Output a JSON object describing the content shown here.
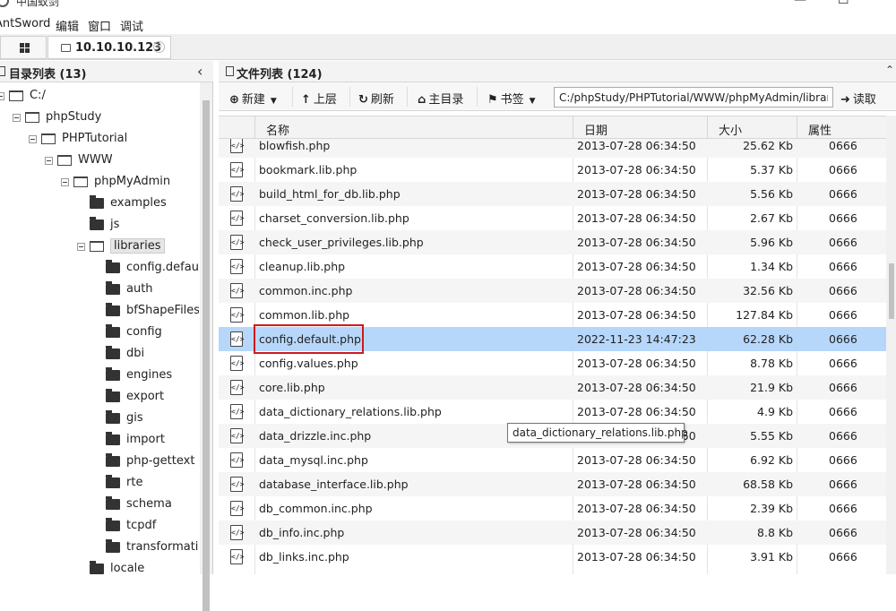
{
  "window": {
    "title": "中国蚁剑",
    "minimize_glyph": "—",
    "maximize_glyph": "☐"
  },
  "menu": {
    "items": [
      "AntSword",
      "编辑",
      "窗口",
      "调试"
    ]
  },
  "tabs": {
    "host_label": "10.10.10.123",
    "close_glyph": "⊗"
  },
  "left_panel": {
    "title": "目录列表 (13)",
    "collapse_glyph": "‹",
    "tree": [
      {
        "label": "C:/",
        "level": 0,
        "type": "open"
      },
      {
        "label": "phpStudy",
        "level": 1,
        "type": "open"
      },
      {
        "label": "PHPTutorial",
        "level": 2,
        "type": "open"
      },
      {
        "label": "WWW",
        "level": 3,
        "type": "open"
      },
      {
        "label": "phpMyAdmin",
        "level": 4,
        "type": "open"
      },
      {
        "label": "examples",
        "level": 5,
        "type": "closed"
      },
      {
        "label": "js",
        "level": 5,
        "type": "closed"
      },
      {
        "label": "libraries",
        "level": 5,
        "type": "open",
        "selected": true
      },
      {
        "label": "config.default.",
        "level": 6,
        "type": "closed"
      },
      {
        "label": "auth",
        "level": 6,
        "type": "closed"
      },
      {
        "label": "bfShapeFiles",
        "level": 6,
        "type": "closed"
      },
      {
        "label": "config",
        "level": 6,
        "type": "closed"
      },
      {
        "label": "dbi",
        "level": 6,
        "type": "closed"
      },
      {
        "label": "engines",
        "level": 6,
        "type": "closed"
      },
      {
        "label": "export",
        "level": 6,
        "type": "closed"
      },
      {
        "label": "gis",
        "level": 6,
        "type": "closed"
      },
      {
        "label": "import",
        "level": 6,
        "type": "closed"
      },
      {
        "label": "php-gettext",
        "level": 6,
        "type": "closed"
      },
      {
        "label": "rte",
        "level": 6,
        "type": "closed"
      },
      {
        "label": "schema",
        "level": 6,
        "type": "closed"
      },
      {
        "label": "tcpdf",
        "level": 6,
        "type": "closed"
      },
      {
        "label": "transformation",
        "level": 6,
        "type": "closed"
      },
      {
        "label": "locale",
        "level": 5,
        "type": "closed"
      }
    ]
  },
  "right_panel": {
    "title": "文件列表 (124)",
    "toolbar": {
      "new_label": "新建",
      "up_label": "上层",
      "refresh_label": "刷新",
      "home_label": "主目录",
      "bookmark_label": "书签",
      "path_value": "C:/phpStudy/PHPTutorial/WWW/phpMyAdmin/libraries/",
      "read_label": "读取"
    },
    "columns": [
      "名称",
      "日期",
      "大小",
      "属性"
    ],
    "files": [
      {
        "name": "blowfish.php",
        "date": "2013-07-28 06:34:50",
        "size": "25.62 Kb",
        "attr": "0666"
      },
      {
        "name": "bookmark.lib.php",
        "date": "2013-07-28 06:34:50",
        "size": "5.37 Kb",
        "attr": "0666"
      },
      {
        "name": "build_html_for_db.lib.php",
        "date": "2013-07-28 06:34:50",
        "size": "5.56 Kb",
        "attr": "0666"
      },
      {
        "name": "charset_conversion.lib.php",
        "date": "2013-07-28 06:34:50",
        "size": "2.67 Kb",
        "attr": "0666"
      },
      {
        "name": "check_user_privileges.lib.php",
        "date": "2013-07-28 06:34:50",
        "size": "5.96 Kb",
        "attr": "0666"
      },
      {
        "name": "cleanup.lib.php",
        "date": "2013-07-28 06:34:50",
        "size": "1.34 Kb",
        "attr": "0666"
      },
      {
        "name": "common.inc.php",
        "date": "2013-07-28 06:34:50",
        "size": "32.56 Kb",
        "attr": "0666"
      },
      {
        "name": "common.lib.php",
        "date": "2013-07-28 06:34:50",
        "size": "127.84 Kb",
        "attr": "0666"
      },
      {
        "name": "config.default.php",
        "date": "2022-11-23 14:47:23",
        "size": "62.28 Kb",
        "attr": "0666",
        "selected": true
      },
      {
        "name": "config.values.php",
        "date": "2013-07-28 06:34:50",
        "size": "8.78 Kb",
        "attr": "0666"
      },
      {
        "name": "core.lib.php",
        "date": "2013-07-28 06:34:50",
        "size": "21.9 Kb",
        "attr": "0666"
      },
      {
        "name": "data_dictionary_relations.lib.php",
        "date": "2013-07-28 06:34:50",
        "size": "4.9 Kb",
        "attr": "0666"
      },
      {
        "name": "data_drizzle.inc.php",
        "date": "2013-07-28 06:34:50",
        "size": "5.55 Kb",
        "attr": "0666"
      },
      {
        "name": "data_mysql.inc.php",
        "date": "2013-07-28 06:34:50",
        "size": "6.92 Kb",
        "attr": "0666"
      },
      {
        "name": "database_interface.lib.php",
        "date": "2013-07-28 06:34:50",
        "size": "68.58 Kb",
        "attr": "0666"
      },
      {
        "name": "db_common.inc.php",
        "date": "2013-07-28 06:34:50",
        "size": "2.39 Kb",
        "attr": "0666"
      },
      {
        "name": "db_info.inc.php",
        "date": "2013-07-28 06:34:50",
        "size": "8.8 Kb",
        "attr": "0666"
      },
      {
        "name": "db_links.inc.php",
        "date": "2013-07-28 06:34:50",
        "size": "3.91 Kb",
        "attr": "0666"
      }
    ],
    "tooltip": "data_dictionary_relations.lib.php",
    "file_icon_glyph": "<∕>"
  },
  "colors": {
    "selected_row": "#b7d7fa",
    "highlight_border": "#d0191f",
    "alt_row": "#f5f5f5"
  }
}
